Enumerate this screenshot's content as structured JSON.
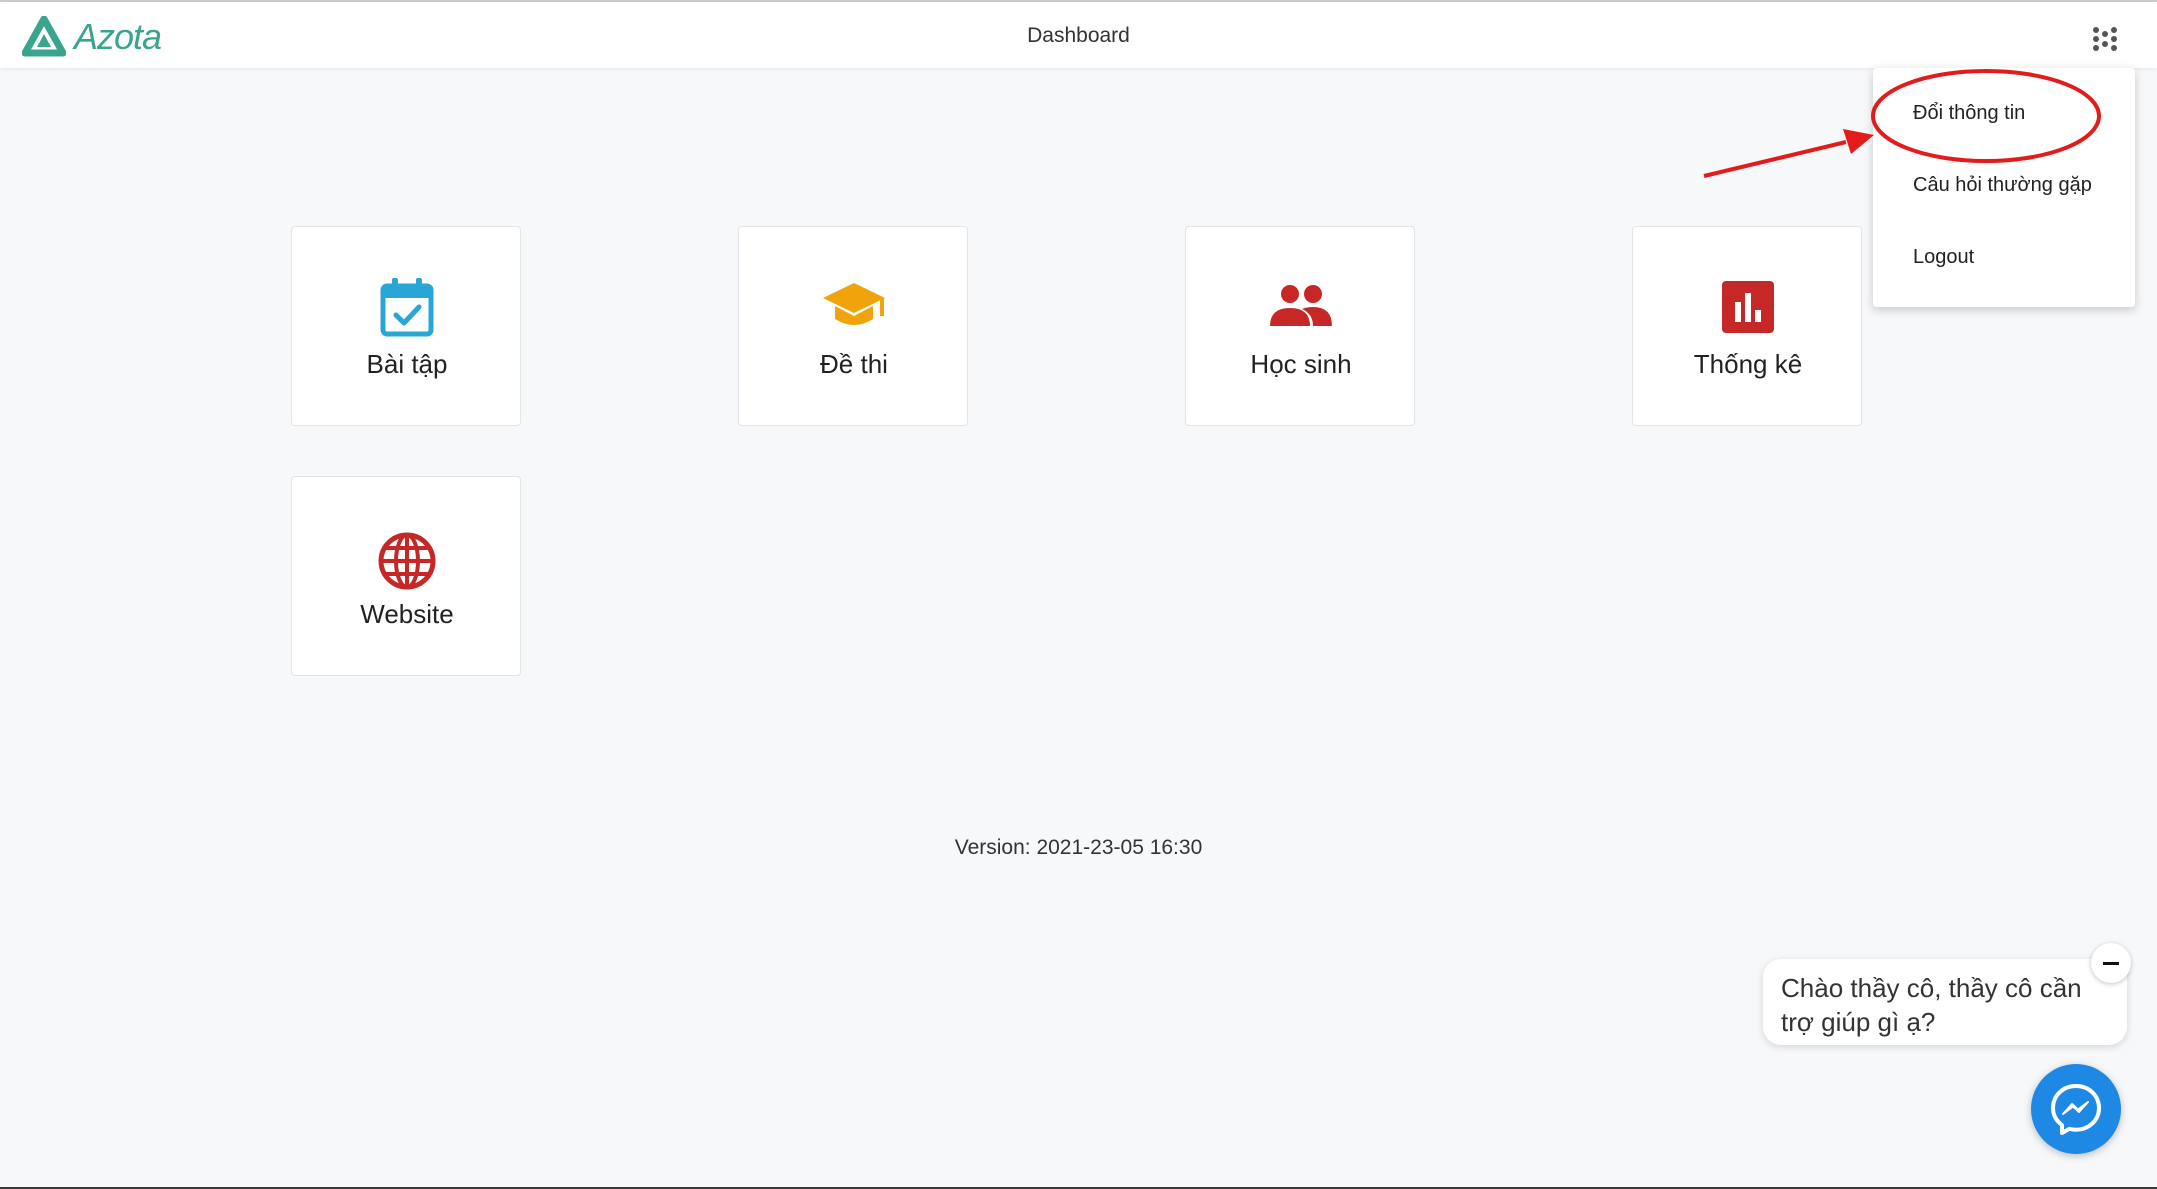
{
  "header": {
    "brand": "Azota",
    "title": "Dashboard"
  },
  "cards": [
    {
      "label": "Bài tập",
      "icon": "calendar-check-icon",
      "color": "#29a5d6"
    },
    {
      "label": "Đề thi",
      "icon": "graduation-cap-icon",
      "color": "#f0a30a"
    },
    {
      "label": "Học sinh",
      "icon": "users-icon",
      "color": "#c62828"
    },
    {
      "label": "Thống kê",
      "icon": "bar-chart-icon",
      "color": "#c62828"
    },
    {
      "label": "Website",
      "icon": "globe-icon",
      "color": "#c62828"
    }
  ],
  "dropdown_menu": {
    "items": [
      {
        "label": "Đổi thông tin",
        "highlighted": true
      },
      {
        "label": "Câu hỏi thường gặp"
      },
      {
        "label": "Logout"
      }
    ],
    "highlight_color": "#e21b1b"
  },
  "footer": {
    "version": "Version: 2021-23-05 16:30"
  },
  "chat_widget": {
    "greeting": "Chào thầy cô, thầy cô cần trợ giúp gì ạ?",
    "close_icon": "minus-icon",
    "launcher_icon": "messenger-icon",
    "launcher_color": "#1e88e5"
  },
  "colors": {
    "brand": "#3aa58f",
    "background": "#f7f8fa"
  }
}
